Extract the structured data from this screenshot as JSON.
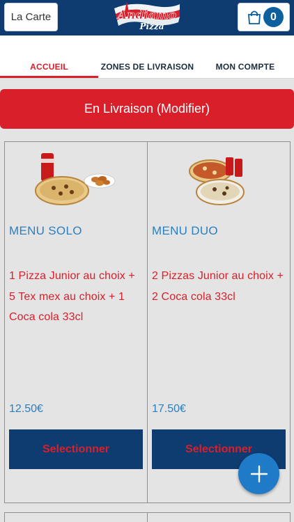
{
  "header": {
    "menu_label": "La Carte",
    "logo_text": "Andiamo",
    "logo_subtext": "Pizza",
    "cart_count": "0"
  },
  "tabs": [
    {
      "label": "ACCUEIL",
      "active": true
    },
    {
      "label": "ZONES DE LIVRAISON",
      "active": false
    },
    {
      "label": "MON COMPTE",
      "active": false
    }
  ],
  "delivery": {
    "label": "En Livraison (Modifier)"
  },
  "menus": [
    {
      "title": "MENU SOLO",
      "description": "1 Pizza Junior au choix + 5 Tex mex au choix + 1 Coca cola 33cl",
      "price": "12.50€",
      "button_label": "Selectionner"
    },
    {
      "title": "MENU DUO",
      "description": "2 Pizzas Junior au choix + 2 Coca cola 33cl",
      "price": "17.50€",
      "button_label": "Selectionner"
    }
  ],
  "colors": {
    "navy": "#0e3c70",
    "red": "#d81f2a",
    "blue_text": "#2a7fc0",
    "fab_blue": "#1f7bc7",
    "background": "#e4e4e4"
  },
  "icons": [
    "cart-icon",
    "plus-icon"
  ]
}
